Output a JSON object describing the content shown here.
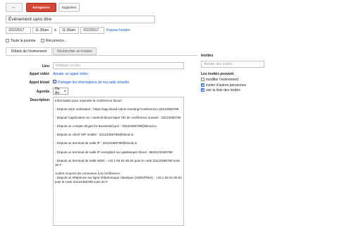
{
  "toolbar": {
    "back_arrow": "←",
    "save_label": "Enregistrer",
    "delete_label": "Supprimer"
  },
  "event": {
    "title": "Événement sans titre",
    "start_date": "2/22/2017",
    "start_time": "11:30am",
    "to_label": "à",
    "end_time": "11:30am",
    "end_date": "2/22/2017",
    "timezone_link": "Fuseau horaire",
    "all_day_label": "Toute la journée",
    "recurrence_label": "Récurrence...",
    "all_day_checked": false,
    "recurrence_checked": false
  },
  "tabs": {
    "details": "Détails de l'événement",
    "find_time": "Rechercher un horaire"
  },
  "form": {
    "location_label": "Lieu",
    "location_placeholder": "Indiquez un lieu",
    "video_label": "Appel vidéo",
    "video_link": "Ajouter un appel vidéo",
    "klood_label": "Appel klood",
    "klood_link": "Partager les informations de ma salle virtuelle",
    "agenda_label": "Agenda",
    "agenda_value": "Hu Ari",
    "description_label": "Description",
    "description_lines": [
      "Information pour rejoindre la conférence klood :",
      "- Depuis votre ordinateur : https://app.klood.io/join-meeting?conference=33123456789",
      "- Depuis l'application ios / android klood taper l'ID de conférence suivant : 33123456789",
      "- Depuis un compte Skype for Business/Lync : 33123456789@klood.io",
      "- Depuis un client SIP mobile : 33123456789@klood.io",
      "- Depuis un terminal de salle IP : 33123456789@klood.io",
      "- Depuis un terminal de salle IP enregistré sur gatekeeper klood : 883312345678​9",
      "- Depuis un terminal de salle ISDN : +33 1 55 51 86 92 puis le code 33123456789 suivi de #",
      "",
      "Autres moyens de connexion à la conférence :\n- Depuis un téléphone sur ligne téléphonique classique (ISDN/PNIS) : +33 1 55 51 86 92  puis le code 33123456789 suivi de #"
    ]
  },
  "guests": {
    "title": "Invités",
    "add_placeholder": "Ajouter des invités",
    "permissions_title": "Les invités peuvent",
    "permissions": [
      {
        "label": "modifier l'événement",
        "checked": false
      },
      {
        "label": "inviter d'autres personnes",
        "checked": true
      },
      {
        "label": "voir la liste des invités",
        "checked": true
      }
    ]
  },
  "colors": {
    "accent": "#d14836",
    "link": "#1155cc",
    "checkbox_checked": "#4d90fe"
  }
}
